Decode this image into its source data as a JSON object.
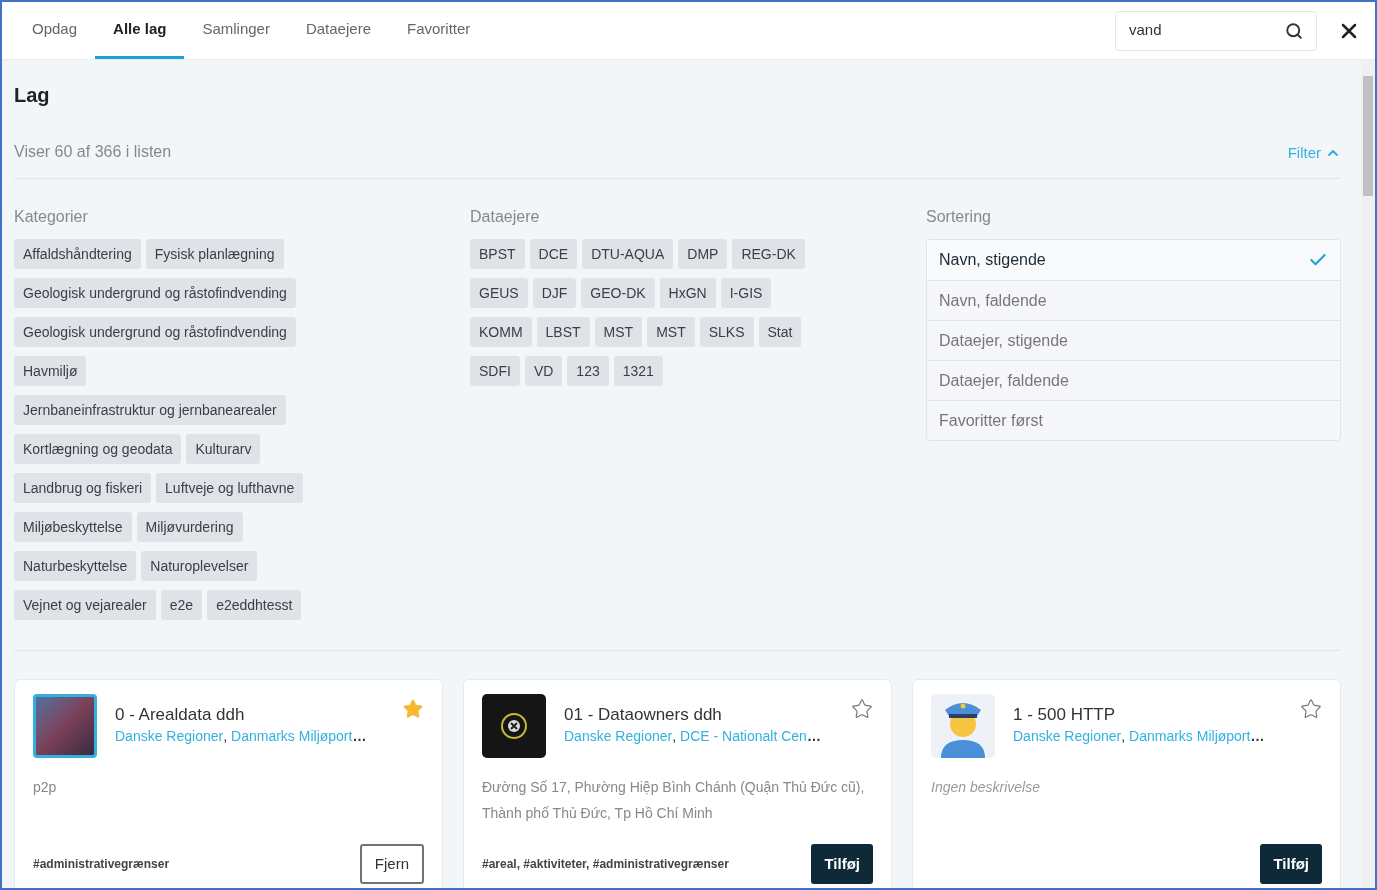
{
  "tabs": [
    {
      "label": "Opdag",
      "selected": false
    },
    {
      "label": "Alle lag",
      "selected": true
    },
    {
      "label": "Samlinger",
      "selected": false
    },
    {
      "label": "Dataejere",
      "selected": false
    },
    {
      "label": "Favoritter",
      "selected": false
    }
  ],
  "search": {
    "value": "vand"
  },
  "heading": "Lag",
  "count": "Viser 60 af 366 i listen",
  "filter": {
    "label": "Filter",
    "expanded": true
  },
  "categories": {
    "title": "Kategorier",
    "chips": [
      "Affaldshåndtering",
      "Fysisk planlægning",
      "Geologisk undergrund og råstofindvending",
      "Geologisk undergrund og råstofindvending",
      "Havmiljø",
      "Jernbaneinfrastruktur og jernbanearealer",
      "Kortlægning og geodata",
      "Kulturarv",
      "Landbrug og fiskeri",
      "Luftveje og lufthavne",
      "Miljøbeskyttelse",
      "Miljøvurdering",
      "Naturbeskyttelse",
      "Naturoplevelser",
      "Vejnet og vejarealer",
      "e2e",
      "e2eddhtesst"
    ]
  },
  "owners": {
    "title": "Dataejere",
    "chips": [
      "BPST",
      "DCE",
      "DTU-AQUA",
      "DMP",
      "REG-DK",
      "GEUS",
      "DJF",
      "GEO-DK",
      "HxGN",
      "I-GIS",
      "KOMM",
      "LBST",
      "MST",
      "MST",
      "SLKS",
      "Stat",
      "SDFI",
      "VD",
      "123",
      "1321"
    ]
  },
  "sorting": {
    "title": "Sortering",
    "options": [
      {
        "label": "Navn, stigende",
        "selected": true
      },
      {
        "label": "Navn, faldende",
        "selected": false
      },
      {
        "label": "Dataejer, stigende",
        "selected": false
      },
      {
        "label": "Dataejer, faldende",
        "selected": false
      },
      {
        "label": "Favoritter først",
        "selected": false
      }
    ]
  },
  "cards": [
    {
      "title": "0 - Arealdata ddh",
      "owners": [
        "Danske Regioner",
        "Danmarks Miljøport"
      ],
      "separator": ",",
      "overflow": "…",
      "favorite": true,
      "description": "p2p",
      "no_description": false,
      "tags": "#administrativegrænser",
      "added": true,
      "button": "Fjern"
    },
    {
      "title": "01 - Dataowners ddh",
      "owners": [
        "Danske Regioner",
        "DCE - Nationalt Cen"
      ],
      "separator": ",",
      "overflow": "…",
      "favorite": false,
      "description": "Đường Số 17, Phường Hiệp Bình Chánh (Quận Thủ Đức cũ), Thành phố Thủ Đức, Tp Hồ Chí Minh",
      "no_description": false,
      "tags": "#areal, #aktiviteter, #administrativegrænser",
      "added": false,
      "button": "Tilføj"
    },
    {
      "title": "1 - 500 HTTP",
      "owners": [
        "Danske Regioner",
        "Danmarks Miljøport"
      ],
      "separator": ",",
      "overflow": "…",
      "favorite": false,
      "description": "Ingen beskrivelse",
      "no_description": true,
      "added": false,
      "button": "Tilføj"
    }
  ]
}
